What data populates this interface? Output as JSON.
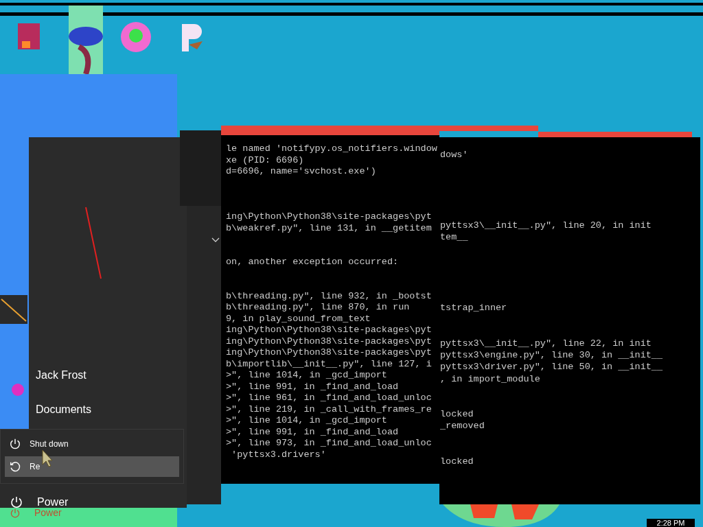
{
  "start_menu": {
    "user": "Jack Frost",
    "items": [
      "Documents"
    ],
    "power_menu": [
      {
        "label": "Shut down",
        "kind": "shutdown",
        "selected": false
      },
      {
        "label": "Re",
        "kind": "restart",
        "selected": true
      }
    ],
    "power_button": "Power",
    "ghost_power": "Power"
  },
  "console": {
    "left_lines": [
      {
        "text": "le named 'notifypy.os_notifiers.window"
      },
      {
        "text": "xe (PID: 6696)"
      },
      {
        "text": "d=6696, name='svchost.exe')"
      },
      {
        "kind": "blank"
      },
      {
        "kind": "blank"
      },
      {
        "kind": "blank"
      },
      {
        "text": "ing\\Python\\Python38\\site-packages\\pyt"
      },
      {
        "text": "b\\weakref.py\", line 131, in __getitem"
      },
      {
        "kind": "blank"
      },
      {
        "kind": "blank"
      },
      {
        "text": "on, another exception occurred:"
      },
      {
        "kind": "blank"
      },
      {
        "kind": "blank"
      },
      {
        "text": "b\\threading.py\", line 932, in _bootst"
      },
      {
        "text": "b\\threading.py\", line 870, in run"
      },
      {
        "text": "9, in play_sound_from_text"
      },
      {
        "text": "ing\\Python\\Python38\\site-packages\\pyt"
      },
      {
        "text": "ing\\Python\\Python38\\site-packages\\pyt"
      },
      {
        "text": "ing\\Python\\Python38\\site-packages\\pyt"
      },
      {
        "text": "b\\importlib\\__init__.py\", line 127, i"
      },
      {
        "text": ">\", line 1014, in _gcd_import"
      },
      {
        "text": ">\", line 991, in _find_and_load"
      },
      {
        "text": ">\", line 961, in _find_and_load_unloc"
      },
      {
        "text": ">\", line 219, in _call_with_frames_re"
      },
      {
        "text": ">\", line 1014, in _gcd_import"
      },
      {
        "text": ">\", line 991, in _find_and_load"
      },
      {
        "text": ">\", line 973, in _find_and_load_unloc"
      },
      {
        "text": " 'pyttsx3.drivers'"
      }
    ],
    "right_lines": [
      {
        "text": "dows'"
      },
      {
        "kind": "blank"
      },
      {
        "kind": "blank"
      },
      {
        "kind": "blank"
      },
      {
        "kind": "blank"
      },
      {
        "kind": "blank"
      },
      {
        "text": "pyttsx3\\__init__.py\", line 20, in init"
      },
      {
        "text": "tem__"
      },
      {
        "kind": "blank"
      },
      {
        "kind": "blank"
      },
      {
        "kind": "blank"
      },
      {
        "kind": "blank"
      },
      {
        "kind": "blank"
      },
      {
        "text": "tstrap_inner"
      },
      {
        "kind": "blank"
      },
      {
        "kind": "blank"
      },
      {
        "text": "pyttsx3\\__init__.py\", line 22, in init"
      },
      {
        "text": "pyttsx3\\engine.py\", line 30, in __init__"
      },
      {
        "text": "pyttsx3\\driver.py\", line 50, in __init__"
      },
      {
        "text": ", in import_module"
      },
      {
        "kind": "blank"
      },
      {
        "kind": "blank"
      },
      {
        "text": "locked"
      },
      {
        "text": "_removed"
      },
      {
        "kind": "blank"
      },
      {
        "kind": "blank"
      },
      {
        "text": "locked"
      }
    ]
  },
  "taskbar": {
    "clock": "2:28 PM"
  }
}
